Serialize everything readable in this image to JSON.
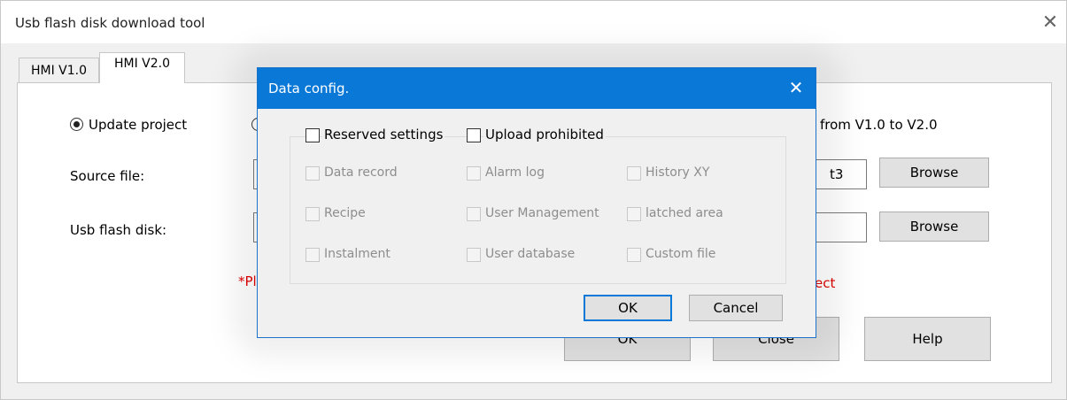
{
  "window": {
    "title": "Usb flash disk download tool",
    "close_glyph": "✕"
  },
  "tabs": [
    {
      "label": "HMI V1.0",
      "selected": false
    },
    {
      "label": "HMI V2.0",
      "selected": true
    }
  ],
  "main": {
    "update_project_label": "Update project",
    "update_project_checked": true,
    "convert_label_visible": "from V1.0 to V2.0",
    "source_file_label": "Source file:",
    "source_file_value_visible": "t3",
    "usb_disk_label": "Usb flash disk:",
    "usb_disk_value_visible": "",
    "browse_label": "Browse",
    "warning_left_visible": "*Pl",
    "warning_right_visible": "ect",
    "ok_label": "OK",
    "close_label": "Close",
    "help_label": "Help"
  },
  "dialog": {
    "title": "Data config.",
    "close_glyph": "✕",
    "reserved_settings_label": "Reserved settings",
    "reserved_settings_checked": false,
    "upload_prohibited_label": "Upload prohibited",
    "upload_prohibited_checked": false,
    "options": [
      {
        "label": "Data record"
      },
      {
        "label": "Alarm log"
      },
      {
        "label": "History XY"
      },
      {
        "label": "Recipe"
      },
      {
        "label": "User Management"
      },
      {
        "label": "latched area"
      },
      {
        "label": "Instalment"
      },
      {
        "label": "User database"
      },
      {
        "label": "Custom file"
      }
    ],
    "ok_label": "OK",
    "cancel_label": "Cancel"
  },
  "colors": {
    "dialog_title_bg": "#0a78d7",
    "warning_text": "#e00000",
    "disabled_text": "#8d8d8d",
    "focus_border": "#0078d7"
  }
}
